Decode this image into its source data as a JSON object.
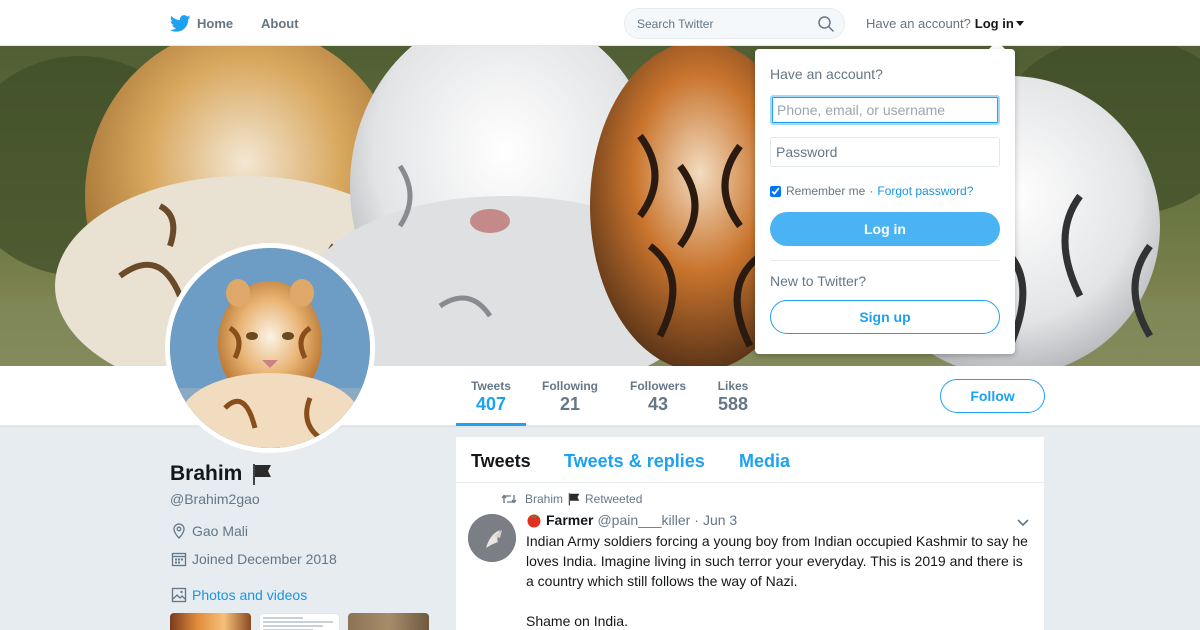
{
  "topbar": {
    "home_label": "Home",
    "about_label": "About",
    "search_placeholder": "Search Twitter",
    "have_account_text": "Have an account?",
    "login_label": "Log in"
  },
  "profile_nav": {
    "stats": [
      {
        "label": "Tweets",
        "value": "407",
        "active": true
      },
      {
        "label": "Following",
        "value": "21",
        "active": false
      },
      {
        "label": "Followers",
        "value": "43",
        "active": false
      },
      {
        "label": "Likes",
        "value": "588",
        "active": false
      }
    ],
    "follow_label": "Follow"
  },
  "profile": {
    "name": "Brahim",
    "handle": "@Brahim2gao",
    "location": "Gao Mali",
    "joined": "Joined December 2018",
    "photos_label": "Photos and videos"
  },
  "timeline": {
    "tabs": [
      {
        "label": "Tweets",
        "active": true
      },
      {
        "label": "Tweets & replies",
        "active": false
      },
      {
        "label": "Media",
        "active": false
      }
    ],
    "tweet": {
      "retweeter": "Brahim",
      "retweeted_text": "Retweeted",
      "author_name": "Farmer",
      "author_handle": "@pain___killer",
      "dot": "·",
      "date": "Jun 3",
      "body_paragraph_1": "Indian Army soldiers forcing a young boy from Indian occupied Kashmir to say he loves India. Imagine living in such terror your everyday. This is 2019 and there is a country which still follows the way of Nazi.",
      "body_paragraph_2": "Shame on India."
    }
  },
  "login_dropdown": {
    "title": "Have an account?",
    "username_placeholder": "Phone, email, or username",
    "password_placeholder": "Password",
    "remember_label": "Remember me",
    "separator": "·",
    "forgot_label": "Forgot password?",
    "login_button": "Log in",
    "new_to_twitter": "New to Twitter?",
    "signup_button": "Sign up"
  },
  "colors": {
    "brand_blue": "#1da1f2",
    "login_button_bg": "#4ab3f4",
    "background": "#e6ecf0"
  },
  "icons": [
    "twitter-bird-icon",
    "search-icon",
    "caret-down-icon",
    "flag-icon",
    "location-pin-icon",
    "calendar-icon",
    "photo-icon",
    "retweet-icon",
    "tomato-emoji-icon",
    "chevron-down-icon"
  ]
}
